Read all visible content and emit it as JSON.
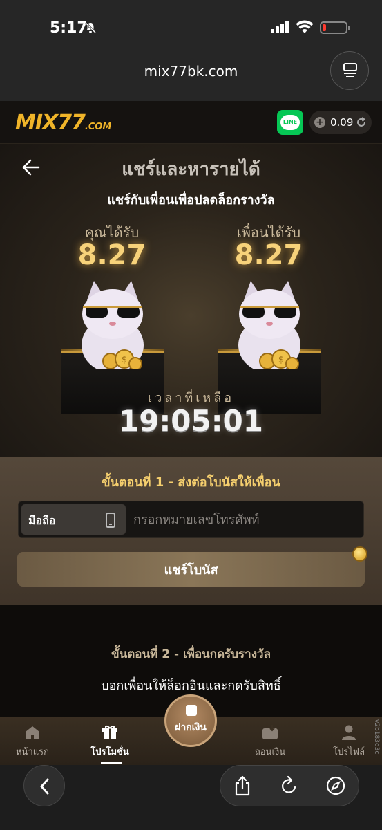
{
  "status_bar": {
    "time": "5:17"
  },
  "browser": {
    "url": "mix77bk.com"
  },
  "site": {
    "logo_main": "MIX77",
    "logo_suffix": ".COM",
    "line_label": "LINE",
    "balance": "0.09"
  },
  "hero": {
    "title": "แชร์และหารายได้",
    "subtitle": "แชร์กับเพื่อนเพื่อปลดล็อกรางวัล",
    "you_label": "คุณได้รับ",
    "you_amount": "8.27",
    "friend_label": "เพื่อนได้รับ",
    "friend_amount": "8.27",
    "timer_label": "เวลาที่เหลือ",
    "timer": "19:05:01"
  },
  "step1": {
    "title": "ขั้นตอนที่ 1 - ส่งต่อโบนัสให้เพื่อน",
    "phone_prefix": "มือถือ",
    "phone_placeholder": "กรอกหมายเลขโทรศัพท์",
    "phone_value": "",
    "share_button": "แชร์โบนัส"
  },
  "step2": {
    "title": "ขั้นตอนที่ 2 - เพื่อนกดรับรางวัล",
    "description": "บอกเพื่อนให้ล็อกอินและกดรับสิทธิ์"
  },
  "bottom_nav": {
    "home": "หน้าแรก",
    "promo": "โปรโมชั่น",
    "deposit": "ฝากเงิน",
    "withdraw": "ถอนเงิน",
    "profile": "โปรไฟล์",
    "version": "v2b183d3c"
  },
  "colors": {
    "accent_gold": "#f0b429",
    "line_green": "#06c755",
    "amount_gold": "#f7d27a"
  }
}
